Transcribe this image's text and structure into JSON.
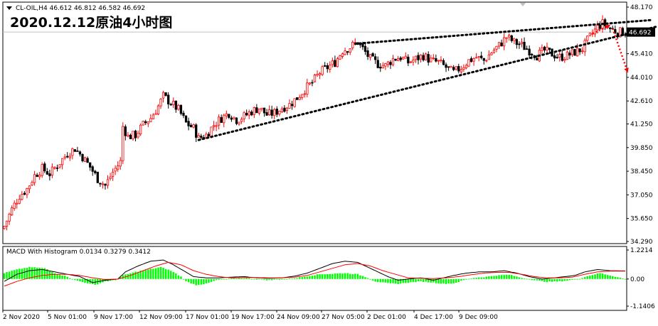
{
  "header": {
    "symbol_info": "CL-OIL,H4  46.612 46.812 46.582 46.692",
    "title": "2020.12.12原油4小时图",
    "current_price": "46.692"
  },
  "macd": {
    "label": "MACD With Histogram 0.0134 0.3279 0.3412"
  },
  "colors": {
    "up": "#ff0000",
    "down": "#000000",
    "macd_line": "#000000",
    "signal_line": "#ff0000",
    "histogram": "#00ff00",
    "trendline": "#000000",
    "forecast_arrow": "#ff0000",
    "badge": "#000000"
  },
  "chart_data": [
    {
      "type": "candlestick",
      "y_ticks": [
        "48.170",
        "46.692",
        "45.410",
        "44.010",
        "42.610",
        "41.250",
        "39.850",
        "38.450",
        "37.050",
        "35.650",
        "34.290"
      ],
      "x_ticks": [
        "2 Nov 2020",
        "5 Nov 01:00",
        "9 Nov 17:00",
        "12 Nov 09:00",
        "17 Nov 01:00",
        "19 Nov 17:00",
        "24 Nov 09:00",
        "27 Nov 05:00",
        "2 Dec 01:00",
        "4 Dec 17:00",
        "9 Dec 09:00"
      ],
      "ylim": [
        34.29,
        48.17
      ],
      "close_path": [
        [
          0,
          35.2
        ],
        [
          3,
          36.2
        ],
        [
          6,
          37.0
        ],
        [
          9,
          37.4
        ],
        [
          12,
          38.2
        ],
        [
          15,
          38.6
        ],
        [
          18,
          38.3
        ],
        [
          21,
          38.8
        ],
        [
          25,
          39.5
        ],
        [
          28,
          39.8
        ],
        [
          31,
          39.3
        ],
        [
          34,
          38.7
        ],
        [
          37,
          38.0
        ],
        [
          40,
          37.6
        ],
        [
          43,
          38.4
        ],
        [
          46,
          39.0
        ],
        [
          47,
          41.1
        ],
        [
          49,
          40.5
        ],
        [
          52,
          40.6
        ],
        [
          55,
          41.2
        ],
        [
          58,
          41.6
        ],
        [
          61,
          42.3
        ],
        [
          63,
          42.9
        ],
        [
          66,
          42.5
        ],
        [
          69,
          42.1
        ],
        [
          72,
          41.3
        ],
        [
          75,
          41.0
        ],
        [
          77,
          40.4
        ],
        [
          80,
          40.6
        ],
        [
          83,
          41.2
        ],
        [
          86,
          41.6
        ],
        [
          89,
          41.9
        ],
        [
          92,
          41.5
        ],
        [
          95,
          41.7
        ],
        [
          98,
          42.0
        ],
        [
          101,
          42.2
        ],
        [
          104,
          41.8
        ],
        [
          107,
          41.9
        ],
        [
          110,
          42.2
        ],
        [
          113,
          42.4
        ],
        [
          116,
          42.8
        ],
        [
          119,
          43.3
        ],
        [
          122,
          43.7
        ],
        [
          125,
          44.3
        ],
        [
          128,
          44.6
        ],
        [
          131,
          44.9
        ],
        [
          134,
          45.6
        ],
        [
          137,
          45.8
        ],
        [
          140,
          46.1
        ],
        [
          142,
          45.7
        ],
        [
          145,
          45.1
        ],
        [
          148,
          44.8
        ],
        [
          151,
          44.7
        ],
        [
          154,
          45.1
        ],
        [
          157,
          45.2
        ],
        [
          160,
          44.9
        ],
        [
          163,
          45.1
        ],
        [
          166,
          45.3
        ],
        [
          169,
          45.0
        ],
        [
          172,
          44.9
        ],
        [
          175,
          44.6
        ],
        [
          178,
          44.3
        ],
        [
          181,
          44.6
        ],
        [
          184,
          45.0
        ],
        [
          187,
          45.2
        ],
        [
          190,
          45.0
        ],
        [
          193,
          45.5
        ],
        [
          196,
          45.9
        ],
        [
          199,
          46.4
        ],
        [
          202,
          46.1
        ],
        [
          205,
          45.9
        ],
        [
          208,
          45.6
        ],
        [
          211,
          45.3
        ],
        [
          214,
          45.6
        ],
        [
          217,
          45.4
        ],
        [
          220,
          45.2
        ],
        [
          223,
          45.3
        ],
        [
          226,
          45.5
        ],
        [
          229,
          45.7
        ],
        [
          231,
          46.2
        ],
        [
          233,
          46.6
        ],
        [
          235,
          47.0
        ],
        [
          237,
          47.2
        ],
        [
          240,
          46.9
        ],
        [
          243,
          46.7
        ],
        [
          246,
          46.69
        ]
      ],
      "n_bars": 247,
      "trendlines": [
        {
          "name": "upper",
          "from": {
            "bar": 139,
            "price": 46.0
          },
          "to": {
            "bar": 256,
            "price": 47.4
          }
        },
        {
          "name": "lower",
          "from": {
            "bar": 77,
            "price": 40.3
          },
          "to": {
            "bar": 258,
            "price": 47.0
          }
        }
      ],
      "forecast": [
        {
          "from": {
            "bar": 233,
            "price": 46.6
          },
          "to": {
            "bar": 240,
            "price": 47.1
          }
        },
        {
          "from": {
            "bar": 241,
            "price": 46.9
          },
          "to": {
            "bar": 247,
            "price": 44.3
          }
        }
      ]
    },
    {
      "type": "macd",
      "y_ticks": [
        "1.2214",
        "0.00",
        "-1.1406"
      ],
      "ylim": [
        -1.1406,
        1.2214
      ],
      "histogram": [
        [
          0,
          0.25
        ],
        [
          5,
          0.4
        ],
        [
          10,
          0.5
        ],
        [
          16,
          0.45
        ],
        [
          20,
          0.25
        ],
        [
          25,
          0.1
        ],
        [
          28,
          -0.05
        ],
        [
          32,
          -0.15
        ],
        [
          36,
          -0.25
        ],
        [
          40,
          -0.1
        ],
        [
          44,
          -0.05
        ],
        [
          47,
          0.15
        ],
        [
          52,
          0.3
        ],
        [
          57,
          0.4
        ],
        [
          62,
          0.5
        ],
        [
          66,
          0.35
        ],
        [
          70,
          0.1
        ],
        [
          72,
          -0.1
        ],
        [
          76,
          -0.25
        ],
        [
          80,
          -0.2
        ],
        [
          84,
          -0.05
        ],
        [
          90,
          0.02
        ],
        [
          96,
          0.05
        ],
        [
          100,
          -0.02
        ],
        [
          105,
          -0.05
        ],
        [
          110,
          -0.02
        ],
        [
          116,
          0.05
        ],
        [
          120,
          0.12
        ],
        [
          125,
          0.2
        ],
        [
          130,
          0.22
        ],
        [
          135,
          0.25
        ],
        [
          140,
          0.2
        ],
        [
          144,
          0.05
        ],
        [
          147,
          -0.1
        ],
        [
          152,
          -0.18
        ],
        [
          156,
          -0.2
        ],
        [
          160,
          -0.15
        ],
        [
          165,
          -0.1
        ],
        [
          170,
          -0.15
        ],
        [
          174,
          -0.2
        ],
        [
          178,
          -0.18
        ],
        [
          182,
          -0.05
        ],
        [
          186,
          0.05
        ],
        [
          190,
          0.08
        ],
        [
          195,
          0.15
        ],
        [
          200,
          0.18
        ],
        [
          205,
          0.05
        ],
        [
          210,
          -0.05
        ],
        [
          215,
          -0.12
        ],
        [
          220,
          -0.1
        ],
        [
          224,
          -0.05
        ],
        [
          228,
          0.02
        ],
        [
          232,
          0.15
        ],
        [
          236,
          0.25
        ],
        [
          240,
          0.15
        ],
        [
          246,
          0.0
        ]
      ],
      "macd_path": [
        [
          0,
          -0.1
        ],
        [
          5,
          0.2
        ],
        [
          10,
          0.35
        ],
        [
          15,
          0.4
        ],
        [
          20,
          0.3
        ],
        [
          25,
          0.2
        ],
        [
          30,
          0.1
        ],
        [
          35,
          -0.15
        ],
        [
          40,
          -0.05
        ],
        [
          45,
          0.0
        ],
        [
          48,
          0.3
        ],
        [
          53,
          0.55
        ],
        [
          58,
          0.75
        ],
        [
          63,
          0.8
        ],
        [
          67,
          0.6
        ],
        [
          71,
          0.35
        ],
        [
          75,
          0.1
        ],
        [
          80,
          0.05
        ],
        [
          85,
          0.05
        ],
        [
          90,
          0.08
        ],
        [
          95,
          0.1
        ],
        [
          100,
          0.05
        ],
        [
          105,
          0.03
        ],
        [
          110,
          0.05
        ],
        [
          115,
          0.12
        ],
        [
          120,
          0.25
        ],
        [
          125,
          0.45
        ],
        [
          130,
          0.65
        ],
        [
          135,
          0.75
        ],
        [
          140,
          0.7
        ],
        [
          144,
          0.5
        ],
        [
          148,
          0.3
        ],
        [
          152,
          0.1
        ],
        [
          156,
          -0.05
        ],
        [
          160,
          0.0
        ],
        [
          165,
          0.05
        ],
        [
          170,
          -0.05
        ],
        [
          174,
          0.05
        ],
        [
          178,
          0.15
        ],
        [
          183,
          0.25
        ],
        [
          188,
          0.3
        ],
        [
          193,
          0.3
        ],
        [
          198,
          0.35
        ],
        [
          203,
          0.25
        ],
        [
          208,
          0.1
        ],
        [
          213,
          0.0
        ],
        [
          218,
          0.05
        ],
        [
          222,
          0.1
        ],
        [
          226,
          0.15
        ],
        [
          230,
          0.3
        ],
        [
          235,
          0.4
        ],
        [
          240,
          0.35
        ],
        [
          246,
          0.34
        ]
      ],
      "signal_path": [
        [
          0,
          -0.3
        ],
        [
          5,
          -0.1
        ],
        [
          10,
          0.05
        ],
        [
          15,
          0.15
        ],
        [
          20,
          0.2
        ],
        [
          25,
          0.2
        ],
        [
          30,
          0.15
        ],
        [
          35,
          0.05
        ],
        [
          40,
          -0.02
        ],
        [
          45,
          0.0
        ],
        [
          50,
          0.15
        ],
        [
          55,
          0.35
        ],
        [
          60,
          0.55
        ],
        [
          65,
          0.7
        ],
        [
          70,
          0.6
        ],
        [
          75,
          0.35
        ],
        [
          80,
          0.2
        ],
        [
          85,
          0.1
        ],
        [
          90,
          0.05
        ],
        [
          95,
          0.06
        ],
        [
          100,
          0.06
        ],
        [
          105,
          0.05
        ],
        [
          110,
          0.05
        ],
        [
          115,
          0.08
        ],
        [
          120,
          0.15
        ],
        [
          125,
          0.3
        ],
        [
          130,
          0.45
        ],
        [
          135,
          0.6
        ],
        [
          140,
          0.65
        ],
        [
          145,
          0.55
        ],
        [
          150,
          0.35
        ],
        [
          155,
          0.2
        ],
        [
          160,
          0.05
        ],
        [
          165,
          0.03
        ],
        [
          170,
          0.02
        ],
        [
          175,
          0.05
        ],
        [
          180,
          0.1
        ],
        [
          185,
          0.18
        ],
        [
          190,
          0.25
        ],
        [
          195,
          0.28
        ],
        [
          200,
          0.28
        ],
        [
          205,
          0.2
        ],
        [
          210,
          0.1
        ],
        [
          215,
          0.05
        ],
        [
          220,
          0.05
        ],
        [
          225,
          0.08
        ],
        [
          230,
          0.2
        ],
        [
          235,
          0.3
        ],
        [
          240,
          0.33
        ],
        [
          246,
          0.33
        ]
      ]
    }
  ]
}
